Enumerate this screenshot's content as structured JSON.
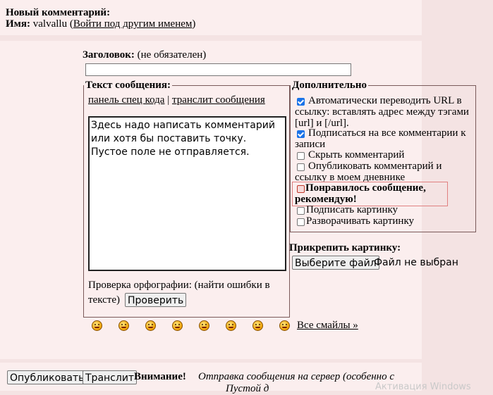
{
  "header": {
    "title": "Новый комментарий:",
    "name_label": "Имя:",
    "username": "valvallu",
    "open_paren": "(",
    "login_other_link": "Войти под другим именем",
    "close_paren": ")"
  },
  "subject": {
    "label": "Заголовок:",
    "optional_note": "(не обязателен)",
    "value": ""
  },
  "message": {
    "legend": "Текст сообщения:",
    "special_code_link": "панель спец кода",
    "separator": "|",
    "translit_link": "транслит сообщения",
    "text": "Здесь надо написать комментарий или хотя бы поставить точку. Пустое поле не отправляется.",
    "spellcheck_line1": "Проверка орфографии: (найти ошибки в",
    "spellcheck_line2": "тексте)",
    "check_button": "Проверить"
  },
  "extra": {
    "legend": "Дополнительно",
    "auto_url_line1": "Автоматически переводить URL в",
    "auto_url_line2": "ссылку: вставлять адрес между тэгами",
    "auto_url_line3": "[url] и [/url].",
    "subscribe_line1": "Подписаться на все комментарии к",
    "subscribe_line2": "записи",
    "hide_comment": "Скрыть комментарий",
    "publish_line1": "Опубликовать комментарий и",
    "publish_line2": "ссылку в моем дневнике",
    "recommend_line1": "Понравилось сообщение,",
    "recommend_line2": "рекомендую!",
    "sign_picture": "Подписать картинку",
    "expand_picture": "Разворачивать картинку"
  },
  "attach": {
    "label": "Прикрепить картинку:",
    "choose_button": "Выберите файл",
    "no_file": "Файл не выбран"
  },
  "smileys": {
    "all_link": "Все смайлы »",
    "icons": [
      "grin-smiley-icon",
      "confused-smiley-icon",
      "smile-smiley-icon",
      "worried-smiley-icon",
      "laugh-smiley-icon",
      "cool-smiley-icon",
      "tongue-smiley-icon",
      "surprised-smiley-icon"
    ]
  },
  "footer": {
    "publish_button": "Опубликовать",
    "translit_button": "Транслит",
    "warning_label": "Внимание!",
    "warning_text": "Отправка сообщения на сервер (особенно с",
    "warning_text_2": "Пустой                    д"
  },
  "watermark": "Активация Windows"
}
